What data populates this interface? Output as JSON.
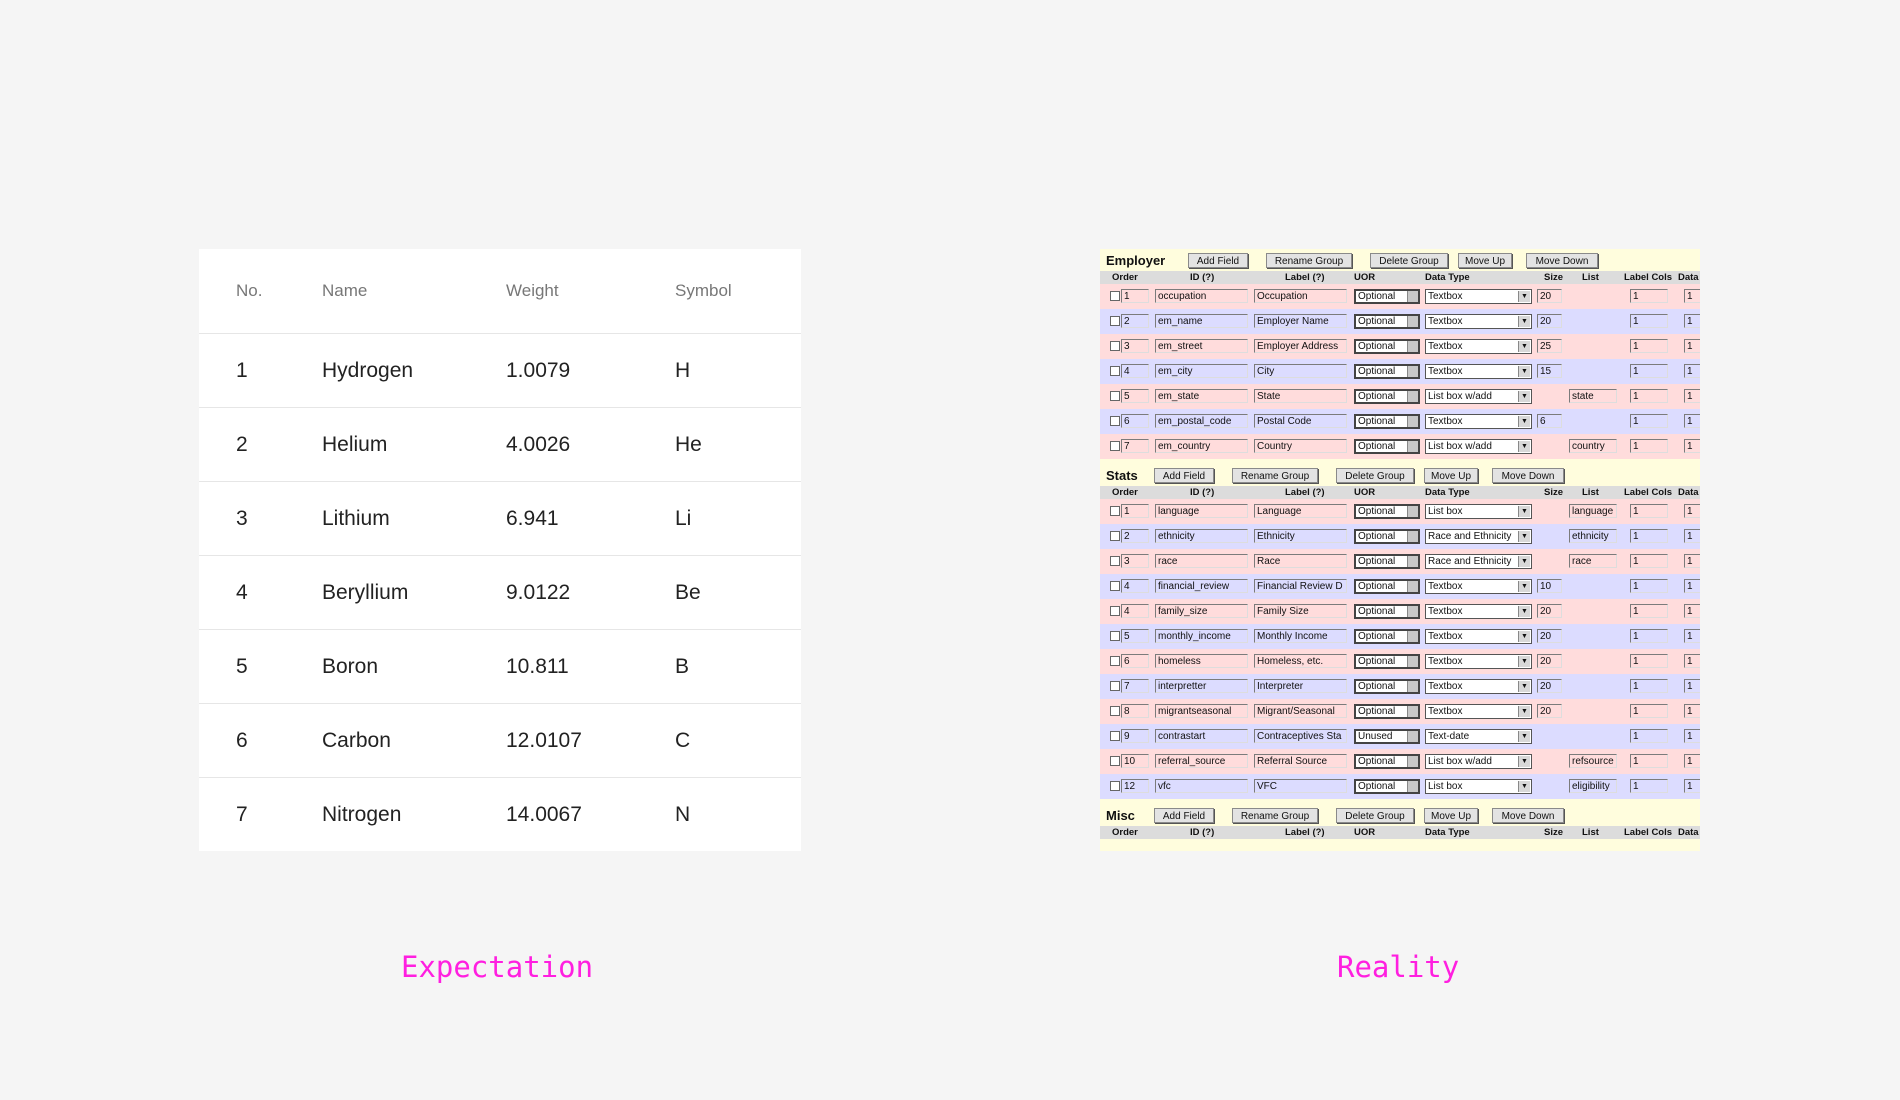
{
  "expectation": {
    "caption": "Expectation",
    "headers": [
      "No.",
      "Name",
      "Weight",
      "Symbol"
    ],
    "rows": [
      [
        "1",
        "Hydrogen",
        "1.0079",
        "H"
      ],
      [
        "2",
        "Helium",
        "4.0026",
        "He"
      ],
      [
        "3",
        "Lithium",
        "6.941",
        "Li"
      ],
      [
        "4",
        "Beryllium",
        "9.0122",
        "Be"
      ],
      [
        "5",
        "Boron",
        "10.811",
        "B"
      ],
      [
        "6",
        "Carbon",
        "12.0107",
        "C"
      ],
      [
        "7",
        "Nitrogen",
        "14.0067",
        "N"
      ]
    ]
  },
  "reality": {
    "caption": "Reality",
    "buttons": [
      "Add Field",
      "Rename Group",
      "Delete Group",
      "Move Up",
      "Move Down"
    ],
    "columns": [
      "Order",
      "ID (?)",
      "Label (?)",
      "UOR",
      "Data Type",
      "Size",
      "List",
      "Label Cols",
      "Data"
    ],
    "groups": [
      {
        "name": "Employer",
        "buttons": [
          "Add Field",
          "Rename Group",
          "Delete Group",
          "Move Up",
          "Move Down"
        ],
        "rows": [
          {
            "order": "1",
            "id": "occupation",
            "label": "Occupation",
            "uor": "Optional",
            "type": "Textbox",
            "size": "20",
            "list": "",
            "lcols": "1",
            "data": "1"
          },
          {
            "order": "2",
            "id": "em_name",
            "label": "Employer Name",
            "uor": "Optional",
            "type": "Textbox",
            "size": "20",
            "list": "",
            "lcols": "1",
            "data": "1"
          },
          {
            "order": "3",
            "id": "em_street",
            "label": "Employer Address",
            "uor": "Optional",
            "type": "Textbox",
            "size": "25",
            "list": "",
            "lcols": "1",
            "data": "1"
          },
          {
            "order": "4",
            "id": "em_city",
            "label": "City",
            "uor": "Optional",
            "type": "Textbox",
            "size": "15",
            "list": "",
            "lcols": "1",
            "data": "1"
          },
          {
            "order": "5",
            "id": "em_state",
            "label": "State",
            "uor": "Optional",
            "type": "List box w/add",
            "size": "",
            "list": "state",
            "lcols": "1",
            "data": "1"
          },
          {
            "order": "6",
            "id": "em_postal_code",
            "label": "Postal Code",
            "uor": "Optional",
            "type": "Textbox",
            "size": "6",
            "list": "",
            "lcols": "1",
            "data": "1"
          },
          {
            "order": "7",
            "id": "em_country",
            "label": "Country",
            "uor": "Optional",
            "type": "List box w/add",
            "size": "",
            "list": "country",
            "lcols": "1",
            "data": "1"
          }
        ]
      },
      {
        "name": "Stats",
        "buttons": [
          "Add Field",
          "Rename Group",
          "Delete Group",
          "Move Up",
          "Move Down"
        ],
        "rows": [
          {
            "order": "1",
            "id": "language",
            "label": "Language",
            "uor": "Optional",
            "type": "List box",
            "size": "",
            "list": "language",
            "lcols": "1",
            "data": "1"
          },
          {
            "order": "2",
            "id": "ethnicity",
            "label": "Ethnicity",
            "uor": "Optional",
            "type": "Race and Ethnicity",
            "size": "",
            "list": "ethnicity",
            "lcols": "1",
            "data": "1"
          },
          {
            "order": "3",
            "id": "race",
            "label": "Race",
            "uor": "Optional",
            "type": "Race and Ethnicity",
            "size": "",
            "list": "race",
            "lcols": "1",
            "data": "1"
          },
          {
            "order": "4",
            "id": "financial_review",
            "label": "Financial Review D",
            "uor": "Optional",
            "type": "Textbox",
            "size": "10",
            "list": "",
            "lcols": "1",
            "data": "1"
          },
          {
            "order": "4",
            "id": "family_size",
            "label": "Family Size",
            "uor": "Optional",
            "type": "Textbox",
            "size": "20",
            "list": "",
            "lcols": "1",
            "data": "1"
          },
          {
            "order": "5",
            "id": "monthly_income",
            "label": "Monthly Income",
            "uor": "Optional",
            "type": "Textbox",
            "size": "20",
            "list": "",
            "lcols": "1",
            "data": "1"
          },
          {
            "order": "6",
            "id": "homeless",
            "label": "Homeless, etc.",
            "uor": "Optional",
            "type": "Textbox",
            "size": "20",
            "list": "",
            "lcols": "1",
            "data": "1"
          },
          {
            "order": "7",
            "id": "interpretter",
            "label": "Interpreter",
            "uor": "Optional",
            "type": "Textbox",
            "size": "20",
            "list": "",
            "lcols": "1",
            "data": "1"
          },
          {
            "order": "8",
            "id": "migrantseasonal",
            "label": "Migrant/Seasonal",
            "uor": "Optional",
            "type": "Textbox",
            "size": "20",
            "list": "",
            "lcols": "1",
            "data": "1"
          },
          {
            "order": "9",
            "id": "contrastart",
            "label": "Contraceptives Sta",
            "uor": "Unused",
            "type": "Text-date",
            "size": "",
            "list": "",
            "lcols": "1",
            "data": "1"
          },
          {
            "order": "10",
            "id": "referral_source",
            "label": "Referral Source",
            "uor": "Optional",
            "type": "List box w/add",
            "size": "",
            "list": "refsource",
            "lcols": "1",
            "data": "1"
          },
          {
            "order": "12",
            "id": "vfc",
            "label": "VFC",
            "uor": "Optional",
            "type": "List box",
            "size": "",
            "list": "eligibility",
            "lcols": "1",
            "data": "1"
          }
        ]
      },
      {
        "name": "Misc",
        "buttons": [
          "Add Field",
          "Rename Group",
          "Delete Group",
          "Move Up",
          "Move Down"
        ],
        "rows": []
      }
    ]
  },
  "colors": {
    "caption": "#ff1fe0",
    "pink_row": "#ffdcdc",
    "blue_row": "#dcdcff",
    "panel_bg": "#fffddd"
  }
}
